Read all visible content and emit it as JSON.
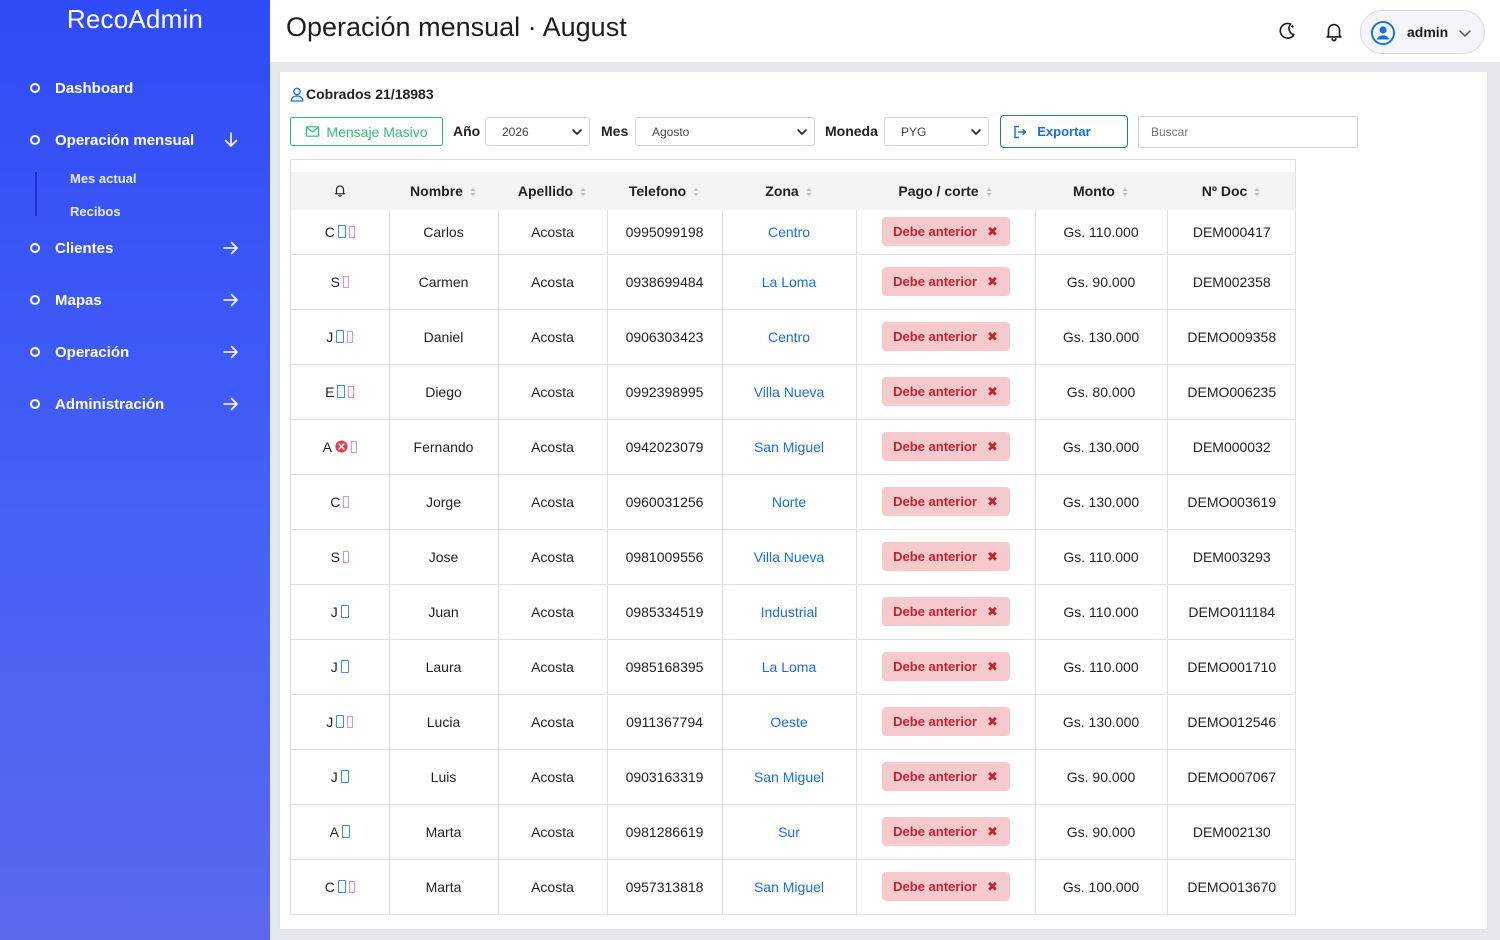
{
  "sidebar": {
    "brand": "RecoAdmin",
    "items": [
      {
        "label": "Dashboard",
        "arrow": "none"
      },
      {
        "label": "Operación mensual",
        "arrow": "down"
      },
      {
        "label": "Clientes",
        "arrow": "right"
      },
      {
        "label": "Mapas",
        "arrow": "right"
      },
      {
        "label": "Operación",
        "arrow": "right"
      },
      {
        "label": "Administración",
        "arrow": "right"
      }
    ],
    "subitems": [
      {
        "label": "Mes actual"
      },
      {
        "label": "Recibos"
      }
    ]
  },
  "header": {
    "title": "Operación mensual · August",
    "user": "admin"
  },
  "toolbar": {
    "cobrados": "Cobrados 21/18983",
    "mensaje_masivo": "Mensaje Masivo",
    "anio_label": "Año",
    "anio_value": "2026",
    "mes_label": "Mes",
    "mes_value": "Agosto",
    "moneda_label": "Moneda",
    "moneda_value": "PYG",
    "exportar": "Exportar",
    "search_placeholder": "Buscar"
  },
  "table": {
    "columns": [
      "Nombre",
      "Apellido",
      "Telefono",
      "Zona",
      "Pago / corte",
      "Monto",
      "Nº Doc"
    ],
    "rows": [
      {
        "initial": "C",
        "icons": [
          "box",
          "pink"
        ],
        "nombre": "Carlos",
        "apellido": "Acosta",
        "telefono": "0995099198",
        "zona": "Centro",
        "pago": "Debe anterior",
        "monto": "Gs. 110.000",
        "doc": "DEM000417"
      },
      {
        "initial": "S",
        "icons": [
          "pink"
        ],
        "nombre": "Carmen",
        "apellido": "Acosta",
        "telefono": "0938699484",
        "zona": "La Loma",
        "pago": "Debe anterior",
        "monto": "Gs. 90.000",
        "doc": "DEM002358"
      },
      {
        "initial": "J",
        "icons": [
          "box",
          "pink"
        ],
        "nombre": "Daniel",
        "apellido": "Acosta",
        "telefono": "0906303423",
        "zona": "Centro",
        "pago": "Debe anterior",
        "monto": "Gs. 130.000",
        "doc": "DEMO009358"
      },
      {
        "initial": "E",
        "icons": [
          "box",
          "pink"
        ],
        "nombre": "Diego",
        "apellido": "Acosta",
        "telefono": "0992398995",
        "zona": "Villa Nueva",
        "pago": "Debe anterior",
        "monto": "Gs. 80.000",
        "doc": "DEMO006235"
      },
      {
        "initial": "A",
        "icons": [
          "red",
          "pink"
        ],
        "nombre": "Fernando",
        "apellido": "Acosta",
        "telefono": "0942023079",
        "zona": "San Miguel",
        "pago": "Debe anterior",
        "monto": "Gs. 130.000",
        "doc": "DEM000032"
      },
      {
        "initial": "C",
        "icons": [
          "pink"
        ],
        "nombre": "Jorge",
        "apellido": "Acosta",
        "telefono": "0960031256",
        "zona": "Norte",
        "pago": "Debe anterior",
        "monto": "Gs. 130.000",
        "doc": "DEMO003619"
      },
      {
        "initial": "S",
        "icons": [
          "pink"
        ],
        "nombre": "Jose",
        "apellido": "Acosta",
        "telefono": "0981009556",
        "zona": "Villa Nueva",
        "pago": "Debe anterior",
        "monto": "Gs. 110.000",
        "doc": "DEM003293"
      },
      {
        "initial": "J",
        "icons": [
          "box"
        ],
        "nombre": "Juan",
        "apellido": "Acosta",
        "telefono": "0985334519",
        "zona": "Industrial",
        "pago": "Debe anterior",
        "monto": "Gs. 110.000",
        "doc": "DEMO011184"
      },
      {
        "initial": "J",
        "icons": [
          "box"
        ],
        "nombre": "Laura",
        "apellido": "Acosta",
        "telefono": "0985168395",
        "zona": "La Loma",
        "pago": "Debe anterior",
        "monto": "Gs. 110.000",
        "doc": "DEMO001710"
      },
      {
        "initial": "J",
        "icons": [
          "box",
          "pink"
        ],
        "nombre": "Lucia",
        "apellido": "Acosta",
        "telefono": "0911367794",
        "zona": "Oeste",
        "pago": "Debe anterior",
        "monto": "Gs. 130.000",
        "doc": "DEMO012546"
      },
      {
        "initial": "J",
        "icons": [
          "box"
        ],
        "nombre": "Luis",
        "apellido": "Acosta",
        "telefono": "0903163319",
        "zona": "San Miguel",
        "pago": "Debe anterior",
        "monto": "Gs. 90.000",
        "doc": "DEMO007067"
      },
      {
        "initial": "A",
        "icons": [
          "box"
        ],
        "nombre": "Marta",
        "apellido": "Acosta",
        "telefono": "0981286619",
        "zona": "Sur",
        "pago": "Debe anterior",
        "monto": "Gs. 90.000",
        "doc": "DEM002130"
      },
      {
        "initial": "C",
        "icons": [
          "box",
          "pink"
        ],
        "nombre": "Marta",
        "apellido": "Acosta",
        "telefono": "0957313818",
        "zona": "San Miguel",
        "pago": "Debe anterior",
        "monto": "Gs. 100.000",
        "doc": "DEMO013670"
      }
    ]
  },
  "colors": {
    "accent": "#2f4bf7",
    "success": "#2fbf71",
    "primary": "#1a6fd8",
    "danger_bg": "#f6c9cc",
    "danger_text": "#c3232f"
  }
}
